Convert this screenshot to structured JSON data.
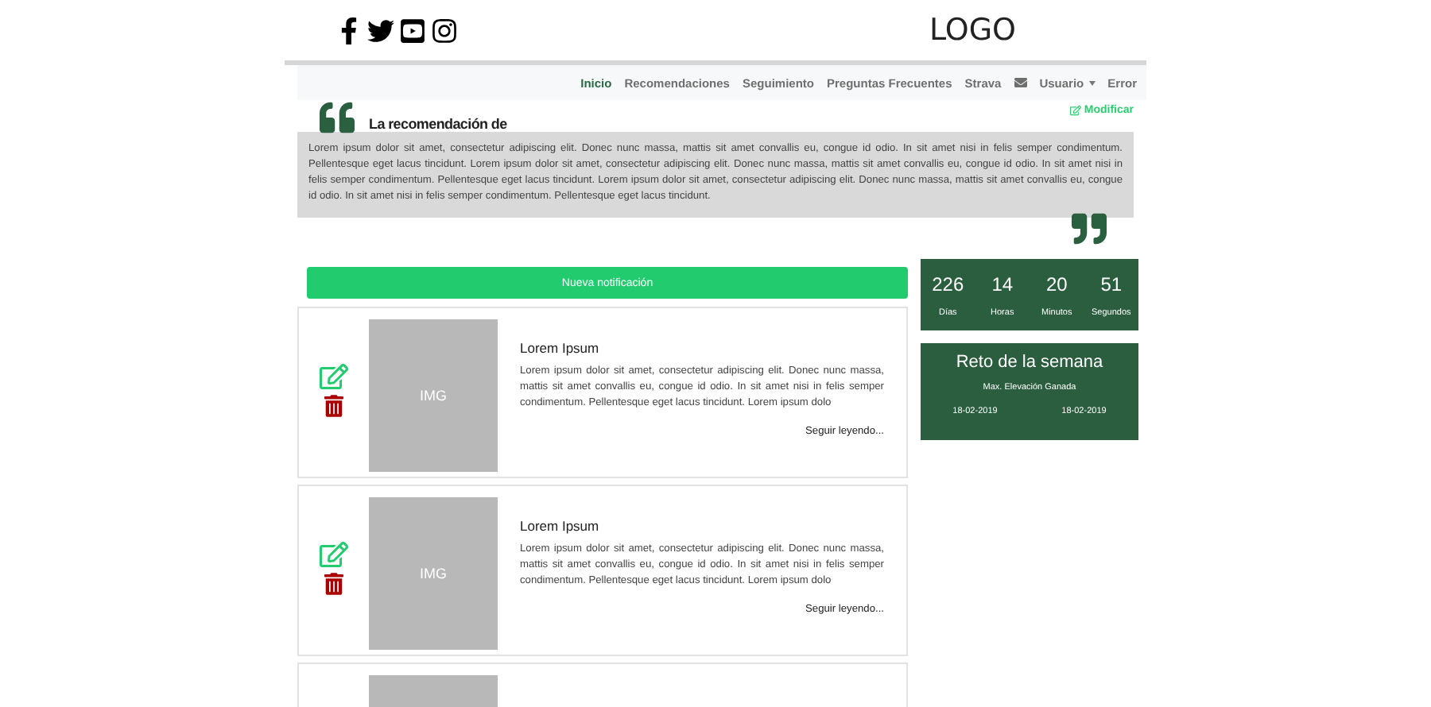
{
  "header": {
    "logo": "LOGO"
  },
  "nav": [
    {
      "kind": "link",
      "label": "Inicio",
      "selected": true
    },
    {
      "kind": "link",
      "label": "Recomendaciones",
      "selected": false
    },
    {
      "kind": "link",
      "label": "Seguimiento",
      "selected": false
    },
    {
      "kind": "link",
      "label": "Preguntas Frecuentes",
      "selected": false
    },
    {
      "kind": "link",
      "label": "Strava",
      "selected": false
    },
    {
      "kind": "icon",
      "selected": false
    },
    {
      "kind": "dropdown",
      "label": "Usuario",
      "selected": false
    },
    {
      "kind": "link",
      "label": "Error",
      "selected": false
    }
  ],
  "recommendation": {
    "title": "La recomendación de",
    "edit": "Modificar",
    "text": "Lorem ipsum dolor sit amet, consectetur adipiscing elit. Donec nunc massa, mattis sit amet convallis eu, congue id odio. In sit amet nisi in felis semper condimentum. Pellentesque eget lacus tincidunt. Lorem ipsum dolor sit amet, consectetur adipiscing elit. Donec nunc massa, mattis sit amet convallis eu, congue id odio. In sit amet nisi in felis semper condimentum. Pellentesque eget lacus tincidunt. Lorem ipsum dolor sit amet, consectetur adipiscing elit. Donec nunc massa, mattis sit amet convallis eu, congue id odio. In sit amet nisi in felis semper condimentum. Pellentesque eget lacus tincidunt."
  },
  "new_button": "Nueva notificación",
  "cards": [
    {
      "kind": "full",
      "image": "IMG",
      "title": "Lorem Ipsum",
      "text": "Lorem ipsum dolor sit amet, consectetur adipiscing elit. Donec nunc massa, mattis sit amet convallis eu, congue id odio. In sit amet nisi in felis semper condimentum. Pellentesque eget lacus tincidunt. Lorem ipsum dolo",
      "link": "Seguir leyendo..."
    },
    {
      "kind": "full",
      "image": "IMG",
      "title": "Lorem Ipsum",
      "text": "Lorem ipsum dolor sit amet, consectetur adipiscing elit. Donec nunc massa, mattis sit amet convallis eu, congue id odio. In sit amet nisi in felis semper condimentum. Pellentesque eget lacus tincidunt. Lorem ipsum dolo",
      "link": "Seguir leyendo..."
    },
    {
      "kind": "partial"
    }
  ],
  "countdown": [
    {
      "value": "226",
      "unit": "Días"
    },
    {
      "value": "14",
      "unit": "Horas"
    },
    {
      "value": "20",
      "unit": "Minutos"
    },
    {
      "value": "51",
      "unit": "Segundos"
    }
  ],
  "challenge": {
    "title": "Reto de la semana",
    "subtitle": "Max. Elevación Ganada",
    "start": "18-02-2019",
    "end": "18-02-2019"
  }
}
